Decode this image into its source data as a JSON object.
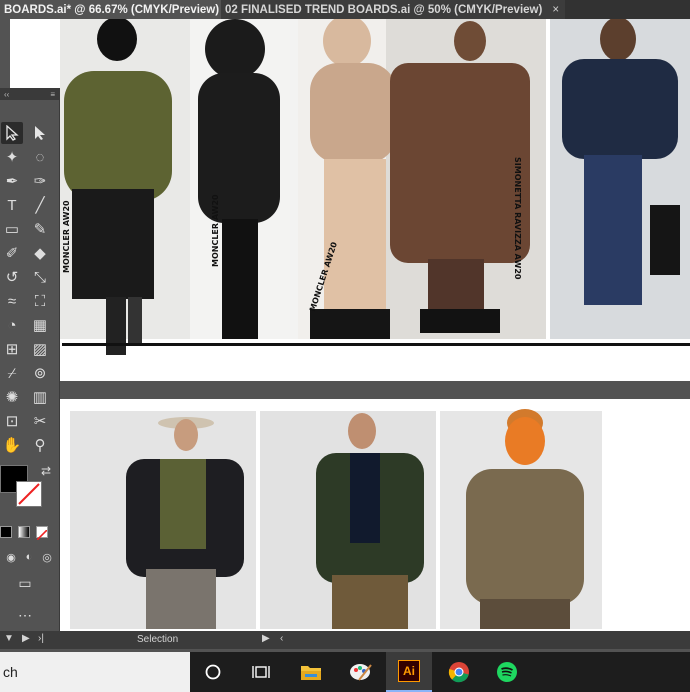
{
  "tabs": [
    {
      "label": "BOARDS.ai* @ 66.67% (CMYK/Preview)",
      "close": "×",
      "active": true
    },
    {
      "label": "02 FINALISED TREND BOARDS.ai @ 50% (CMYK/Preview)",
      "close": "×",
      "active": false
    }
  ],
  "tools_panel": {
    "collapse": "‹‹",
    "menu": "≡"
  },
  "brand_tags": [
    "MONCLER AW20",
    "MONCLER AW20",
    "MONCLER AW20",
    "SIMONETTA RAVIZZA AW20"
  ],
  "statusbar": {
    "tool_name": "Selection",
    "first": "‹",
    "prev": "▼",
    "next": "▶",
    "last": "›|",
    "scroll_left": "‹"
  },
  "taskbar": {
    "search_text": "ch",
    "icons": [
      "cortana-icon",
      "task-view-icon",
      "file-explorer-icon",
      "paint-icon",
      "illustrator-icon",
      "chrome-icon",
      "spotify-icon"
    ],
    "illustrator_label": "Ai"
  },
  "colors": {
    "canvas": "#535353",
    "tab_active": "#535353",
    "tab_inactive": "#3c3c3c",
    "illustrator": "#ff9a00",
    "spotify": "#1ed760"
  }
}
